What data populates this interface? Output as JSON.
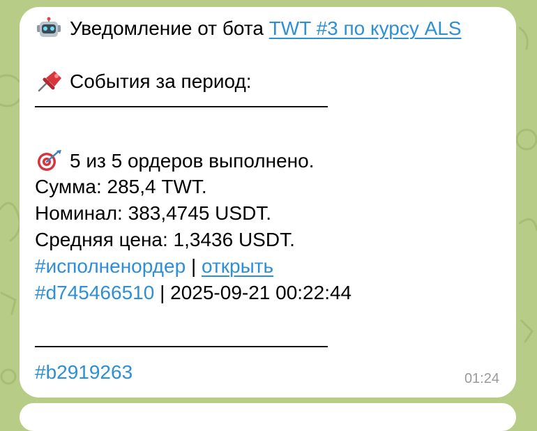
{
  "message": {
    "title_prefix": "Уведомление от бота",
    "bot_link": "TWT #3 по курсу ALS",
    "events_heading": "События за период:",
    "orders_text": "5 из 5 ордеров выполнено.",
    "sum_text": "Сумма: 285,4 TWT.",
    "nominal_text": "Номинал: 383,4745 USDT.",
    "avg_price_text": "Средняя цена: 1,3436 USDT.",
    "hashtag_filled": "#исполненордер",
    "separator": "|",
    "open_link": "открыть",
    "hashtag_order": "#d745466510",
    "datetime_text": "| 2025-09-21 00:22:44",
    "hashtag_bot": "#b2919263",
    "time": "01:24"
  },
  "icons": {
    "title_icon": "robot-icon",
    "events_icon": "pushpin-icon",
    "orders_icon": "target-icon"
  },
  "colors": {
    "chat_background": "#b7cc86",
    "bubble": "#ffffff",
    "link": "#2e8fd6",
    "time": "#9a9a9a"
  }
}
